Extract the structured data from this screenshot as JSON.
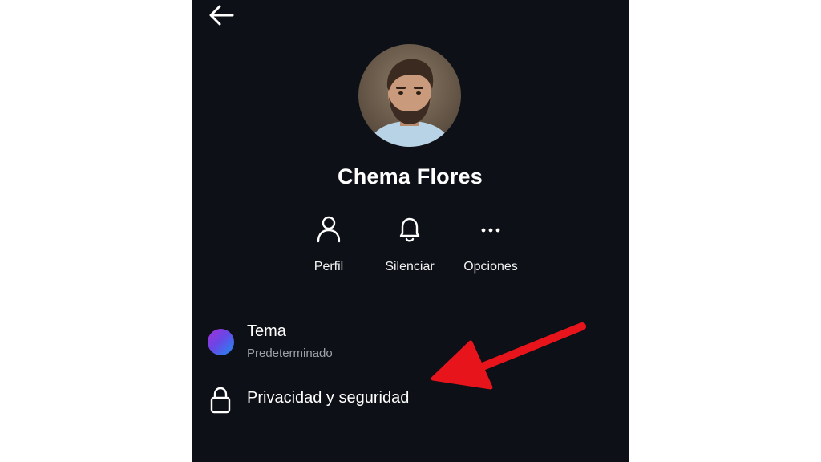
{
  "contact": {
    "name": "Chema Flores"
  },
  "actions": [
    {
      "label": "Perfil",
      "icon": "person-icon"
    },
    {
      "label": "Silenciar",
      "icon": "bell-icon"
    },
    {
      "label": "Opciones",
      "icon": "more-icon"
    }
  ],
  "settings": {
    "tema": {
      "title": "Tema",
      "subtitle": "Predeterminado"
    },
    "privacy": {
      "title": "Privacidad y seguridad"
    }
  },
  "colors": {
    "background": "#0d1016",
    "text": "#ffffff",
    "muted": "#9ca0a8",
    "annotation_arrow": "#e8141c"
  }
}
